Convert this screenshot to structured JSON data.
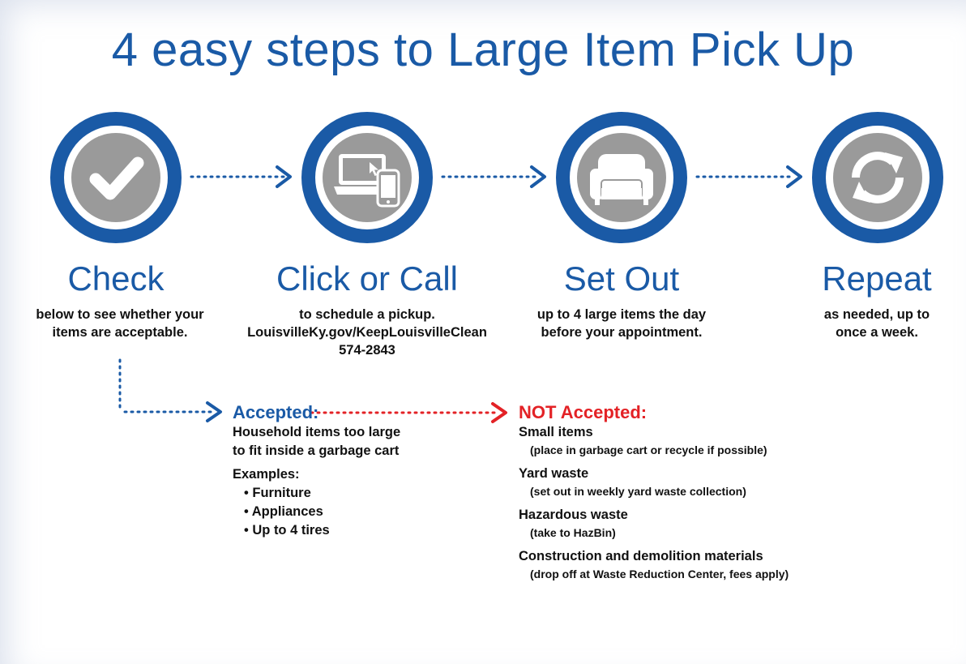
{
  "title": "4 easy steps to Large Item Pick Up",
  "colors": {
    "brand_blue": "#1a5aa6",
    "icon_gray": "#9a9a9a",
    "not_accepted_red": "#e32226"
  },
  "steps": [
    {
      "icon": "checkmark-icon",
      "title": "Check",
      "lines": [
        "below to see whether your",
        "items are acceptable."
      ]
    },
    {
      "icon": "laptop-phone-icon",
      "title": "Click or Call",
      "lines": [
        "to schedule a pickup.",
        "LouisvilleKy.gov/KeepLouisvilleClean",
        "574-2843"
      ]
    },
    {
      "icon": "armchair-icon",
      "title": "Set Out",
      "lines": [
        "up to 4 large items the day",
        "before your appointment."
      ]
    },
    {
      "icon": "refresh-icon",
      "title": "Repeat",
      "lines": [
        "as needed, up to",
        "once a week."
      ]
    }
  ],
  "accepted": {
    "heading": "Accepted:",
    "desc": [
      "Household items too large",
      "to fit inside a garbage cart"
    ],
    "examples_label": "Examples:",
    "examples": [
      "• Furniture",
      "• Appliances",
      "• Up to 4 tires"
    ]
  },
  "not_accepted": {
    "heading": "NOT Accepted:",
    "items": [
      {
        "name": "Small items",
        "note": "(place in garbage cart or recycle if possible)"
      },
      {
        "name": "Yard waste",
        "note": "(set out in weekly yard waste collection)"
      },
      {
        "name": "Hazardous waste",
        "note": "(take to HazBin)"
      },
      {
        "name": "Construction and demolition materials",
        "note": "(drop off at Waste Reduction Center, fees apply)"
      }
    ]
  }
}
